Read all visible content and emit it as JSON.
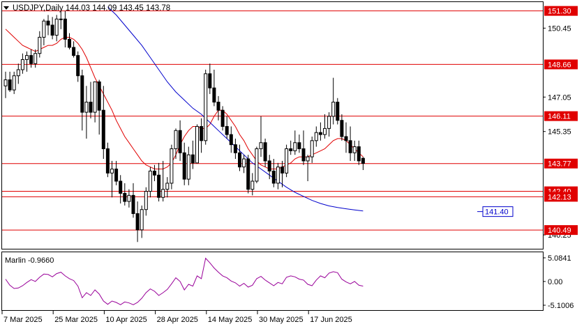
{
  "header": {
    "title_text": "USDJPY,Daily  144.03 144.09 143.45 143.78"
  },
  "indicator": {
    "label": "Marlin -0.9660",
    "color": "#990099",
    "ticks": [
      "5.0841",
      "0.00",
      "-5.1006"
    ],
    "tick_values": [
      5.0841,
      0.0,
      -5.1006
    ]
  },
  "colors": {
    "background": "#ffffff",
    "axis": "#000000",
    "level_line": "#e00000",
    "ma_red": "#e00000",
    "ma_blue": "#0000cc",
    "candle": "#000000",
    "label_text": "#ffffff"
  },
  "chart_data": {
    "type": "candlestick",
    "symbol": "USDJPY",
    "timeframe": "Daily",
    "ylim": [
      139.6,
      151.7
    ],
    "price_ticks": [
      "150.45",
      "147.05",
      "145.35",
      "140.25"
    ],
    "price_tick_values": [
      150.45,
      147.05,
      145.35,
      140.25
    ],
    "x_tick_labels": [
      "7 Mar 2025",
      "25 Mar 2025",
      "10 Apr 2025",
      "28 Apr 2025",
      "14 May 2025",
      "30 May 2025",
      "17 Jun 2025"
    ],
    "x_tick_index": [
      0,
      12,
      24,
      36,
      48,
      60,
      72
    ],
    "levels": [
      {
        "label": "151.30",
        "value": 151.3
      },
      {
        "label": "148.66",
        "value": 148.66
      },
      {
        "label": "146.11",
        "value": 146.11
      },
      {
        "label": "143.77",
        "value": 143.77
      },
      {
        "label": "142.40",
        "value": 142.4
      },
      {
        "label": "142.13",
        "value": 142.13
      },
      {
        "label": "140.49",
        "value": 140.49
      }
    ],
    "blue_ma_label": "141.40",
    "blue_ma_value": 141.4,
    "ohlc": [
      [
        147.6,
        148.3,
        147.0,
        147.9
      ],
      [
        147.9,
        148.3,
        147.3,
        147.4
      ],
      [
        147.4,
        148.3,
        147.2,
        148.1
      ],
      [
        148.1,
        148.7,
        147.7,
        148.4
      ],
      [
        148.4,
        149.2,
        148.2,
        148.9
      ],
      [
        148.9,
        149.3,
        148.3,
        149.1
      ],
      [
        149.1,
        149.4,
        148.5,
        148.7
      ],
      [
        148.7,
        149.4,
        148.5,
        149.2
      ],
      [
        149.2,
        150.3,
        149.0,
        150.0
      ],
      [
        150.0,
        150.9,
        149.6,
        150.8
      ],
      [
        150.8,
        151.1,
        150.1,
        150.6
      ],
      [
        150.6,
        151.0,
        149.9,
        150.1
      ],
      [
        150.1,
        151.1,
        149.8,
        150.9
      ],
      [
        150.9,
        151.3,
        150.4,
        150.9
      ],
      [
        150.9,
        151.3,
        149.5,
        149.9
      ],
      [
        149.9,
        150.2,
        149.4,
        149.5
      ],
      [
        149.5,
        149.8,
        149.0,
        149.1
      ],
      [
        149.1,
        149.3,
        147.8,
        148.1
      ],
      [
        148.1,
        148.4,
        145.4,
        146.3
      ],
      [
        146.3,
        147.6,
        145.0,
        146.8
      ],
      [
        146.8,
        147.8,
        146.0,
        146.3
      ],
      [
        146.3,
        147.8,
        145.8,
        147.8
      ],
      [
        147.8,
        147.9,
        145.2,
        146.4
      ],
      [
        146.4,
        147.6,
        144.0,
        144.5
      ],
      [
        144.5,
        144.8,
        143.1,
        143.3
      ],
      [
        143.3,
        143.9,
        142.1,
        143.5
      ],
      [
        143.5,
        143.9,
        142.7,
        142.9
      ],
      [
        142.9,
        143.2,
        141.8,
        142.3
      ],
      [
        142.3,
        142.8,
        141.7,
        141.9
      ],
      [
        141.9,
        142.5,
        141.6,
        142.2
      ],
      [
        142.2,
        142.8,
        141.1,
        141.3
      ],
      [
        141.3,
        141.9,
        139.9,
        140.5
      ],
      [
        140.5,
        141.7,
        140.1,
        141.5
      ],
      [
        141.5,
        142.6,
        141.2,
        142.4
      ],
      [
        142.4,
        143.6,
        142.1,
        143.4
      ],
      [
        143.4,
        143.7,
        142.9,
        143.2
      ],
      [
        143.2,
        143.8,
        141.9,
        142.1
      ],
      [
        142.1,
        143.9,
        141.9,
        142.5
      ],
      [
        142.5,
        143.1,
        142.1,
        142.8
      ],
      [
        142.8,
        144.7,
        142.5,
        144.5
      ],
      [
        144.5,
        145.5,
        144.0,
        145.4
      ],
      [
        145.4,
        145.9,
        143.9,
        144.3
      ],
      [
        144.3,
        144.8,
        142.7,
        143.0
      ],
      [
        143.0,
        144.6,
        142.7,
        144.2
      ],
      [
        144.2,
        144.9,
        143.5,
        143.8
      ],
      [
        143.8,
        145.7,
        143.8,
        145.6
      ],
      [
        145.6,
        146.0,
        144.3,
        144.9
      ],
      [
        144.9,
        148.4,
        144.7,
        148.2
      ],
      [
        148.2,
        148.7,
        147.2,
        147.5
      ],
      [
        147.5,
        148.4,
        146.6,
        146.8
      ],
      [
        146.8,
        147.1,
        145.9,
        146.4
      ],
      [
        146.4,
        146.6,
        145.4,
        145.6
      ],
      [
        145.6,
        146.1,
        145.0,
        145.2
      ],
      [
        145.2,
        145.6,
        144.3,
        144.7
      ],
      [
        144.7,
        145.0,
        144.0,
        144.3
      ],
      [
        144.3,
        144.7,
        143.4,
        143.6
      ],
      [
        143.6,
        144.2,
        143.3,
        144.0
      ],
      [
        144.0,
        144.2,
        142.3,
        142.5
      ],
      [
        142.5,
        143.3,
        142.2,
        142.9
      ],
      [
        142.9,
        144.6,
        142.8,
        144.5
      ],
      [
        144.5,
        146.1,
        144.1,
        144.8
      ],
      [
        144.8,
        145.0,
        143.6,
        143.9
      ],
      [
        143.9,
        144.2,
        143.0,
        143.4
      ],
      [
        143.4,
        144.0,
        142.6,
        142.8
      ],
      [
        142.8,
        143.8,
        142.5,
        143.6
      ],
      [
        143.6,
        143.9,
        142.6,
        143.3
      ],
      [
        143.3,
        144.7,
        143.1,
        144.5
      ],
      [
        144.5,
        144.9,
        144.2,
        144.4
      ],
      [
        144.4,
        145.4,
        144.2,
        144.8
      ],
      [
        144.8,
        145.2,
        144.3,
        144.5
      ],
      [
        144.5,
        145.4,
        143.7,
        143.9
      ],
      [
        143.9,
        144.2,
        142.9,
        144.1
      ],
      [
        144.1,
        145.1,
        143.8,
        144.9
      ],
      [
        144.9,
        145.6,
        144.6,
        145.3
      ],
      [
        145.3,
        145.8,
        144.9,
        145.2
      ],
      [
        145.2,
        146.2,
        145.0,
        145.5
      ],
      [
        145.5,
        146.3,
        145.1,
        146.1
      ],
      [
        146.1,
        148.0,
        145.7,
        146.8
      ],
      [
        146.8,
        147.0,
        145.7,
        145.9
      ],
      [
        145.9,
        146.2,
        144.9,
        145.1
      ],
      [
        145.1,
        145.8,
        144.3,
        144.9
      ],
      [
        144.9,
        145.6,
        143.9,
        144.3
      ],
      [
        144.3,
        144.9,
        143.9,
        144.6
      ],
      [
        144.6,
        144.9,
        143.7,
        143.9
      ],
      [
        144.03,
        144.09,
        143.45,
        143.78
      ]
    ],
    "ma_red": [
      150.4,
      150.2,
      150.0,
      149.8,
      149.6,
      149.5,
      149.4,
      149.3,
      149.4,
      149.5,
      149.6,
      149.6,
      149.7,
      149.9,
      150.0,
      150.0,
      149.9,
      149.7,
      149.4,
      149.0,
      148.5,
      148.0,
      147.6,
      147.2,
      146.8,
      146.4,
      145.9,
      145.5,
      145.1,
      144.8,
      144.5,
      144.2,
      143.9,
      143.7,
      143.6,
      143.5,
      143.5,
      143.5,
      143.6,
      143.8,
      144.2,
      144.7,
      145.1,
      145.4,
      145.6,
      145.6,
      145.5,
      145.5,
      145.7,
      146.1,
      146.4,
      146.4,
      146.2,
      145.9,
      145.6,
      145.2,
      144.9,
      144.5,
      144.2,
      143.9,
      143.7,
      143.6,
      143.5,
      143.5,
      143.5,
      143.6,
      143.7,
      143.8,
      144.0,
      144.1,
      144.1,
      144.1,
      144.2,
      144.3,
      144.4,
      144.5,
      144.7,
      144.9,
      145.0,
      145.0,
      144.9,
      144.7,
      144.5,
      144.3,
      144.1
    ],
    "ma_blue_points": [
      [
        24,
        151.5
      ],
      [
        26,
        151.1
      ],
      [
        28,
        150.6
      ],
      [
        30,
        150.1
      ],
      [
        32,
        149.6
      ],
      [
        34,
        149.0
      ],
      [
        36,
        148.4
      ],
      [
        38,
        147.8
      ],
      [
        40,
        147.3
      ],
      [
        42,
        146.9
      ],
      [
        44,
        146.5
      ],
      [
        46,
        146.2
      ],
      [
        48,
        145.8
      ],
      [
        50,
        145.4
      ],
      [
        52,
        145.0
      ],
      [
        54,
        144.6
      ],
      [
        56,
        144.2
      ],
      [
        58,
        143.8
      ],
      [
        60,
        143.5
      ],
      [
        62,
        143.2
      ],
      [
        64,
        142.9
      ],
      [
        66,
        142.6
      ],
      [
        68,
        142.35
      ],
      [
        70,
        142.15
      ],
      [
        72,
        141.95
      ],
      [
        74,
        141.8
      ],
      [
        76,
        141.68
      ],
      [
        78,
        141.6
      ],
      [
        80,
        141.54
      ],
      [
        82,
        141.48
      ],
      [
        84,
        141.43
      ]
    ],
    "marlin": [
      0.5,
      -0.8,
      -1.5,
      -1.4,
      -0.9,
      -0.2,
      0.4,
      0.0,
      0.9,
      1.6,
      1.5,
      1.0,
      1.7,
      2.0,
      1.2,
      0.6,
      0.2,
      -1.0,
      -3.5,
      -2.4,
      -3.0,
      -1.8,
      -2.7,
      -4.2,
      -4.9,
      -4.2,
      -4.5,
      -5.0,
      -4.4,
      -4.6,
      -5.0,
      -4.5,
      -3.6,
      -2.4,
      -1.6,
      -2.1,
      -3.0,
      -2.4,
      -1.7,
      -0.5,
      0.8,
      0.0,
      -1.8,
      -0.6,
      -1.0,
      1.2,
      0.6,
      5.0,
      4.0,
      2.9,
      2.0,
      1.2,
      0.8,
      0.1,
      -0.3,
      -1.0,
      -0.4,
      -1.2,
      -0.8,
      0.6,
      1.1,
      0.3,
      -0.3,
      -0.9,
      -0.2,
      -0.5,
      0.9,
      1.2,
      1.0,
      0.5,
      0.3,
      -0.6,
      -0.9,
      0.3,
      1.2,
      0.8,
      1.8,
      2.1,
      1.9,
      0.5,
      -0.1,
      -0.5,
      0.0,
      -0.8,
      -1.0
    ]
  }
}
